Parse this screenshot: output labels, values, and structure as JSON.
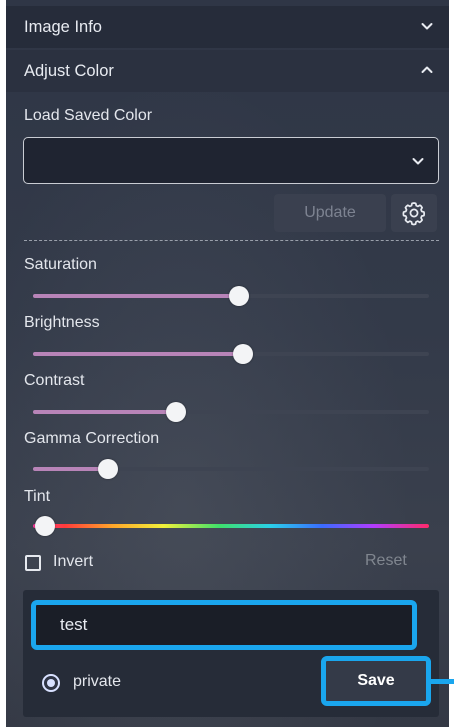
{
  "panel": {
    "sections": {
      "image_info": {
        "label": "Image Info",
        "expanded": false
      },
      "adjust_color": {
        "label": "Adjust Color",
        "expanded": true
      }
    }
  },
  "adjust_color": {
    "load_saved_label": "Load Saved Color",
    "saved_select": {
      "value": ""
    },
    "update_label": "Update",
    "sliders": [
      {
        "label": "Saturation",
        "value": 0.52
      },
      {
        "label": "Brightness",
        "value": 0.53
      },
      {
        "label": "Contrast",
        "value": 0.36
      },
      {
        "label": "Gamma Correction",
        "value": 0.19
      },
      {
        "label": "Tint",
        "value": 0.03
      }
    ],
    "invert_label": "Invert",
    "invert_checked": false,
    "reset_label": "Reset"
  },
  "save_form": {
    "name_value": "test",
    "visibility_label": "private",
    "visibility_selected": true,
    "save_label": "Save"
  },
  "colors": {
    "accent_highlight": "#1aa6ee",
    "slider_fill": "#b884b8",
    "panel_header": "#262c3a"
  }
}
